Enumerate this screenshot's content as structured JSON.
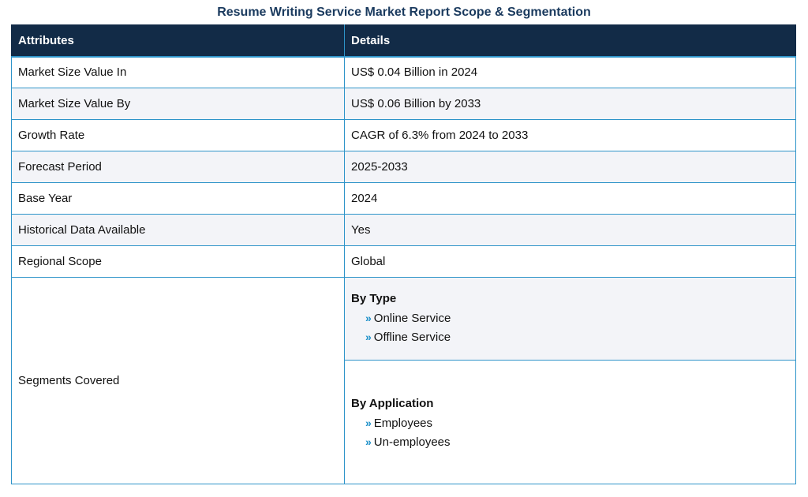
{
  "title": "Resume Writing Service Market Report Scope & Segmentation",
  "table": {
    "headers": [
      "Attributes",
      "Details"
    ],
    "rows": [
      {
        "attribute": "Market Size Value In",
        "detail": "US$ 0.04 Billion in 2024"
      },
      {
        "attribute": "Market Size Value By",
        "detail": "US$ 0.06 Billion by 2033"
      },
      {
        "attribute": "Growth Rate",
        "detail": "CAGR of 6.3% from 2024 to 2033"
      },
      {
        "attribute": "Forecast Period",
        "detail": "2025-2033"
      },
      {
        "attribute": "Base Year",
        "detail": "2024"
      },
      {
        "attribute": "Historical Data Available",
        "detail": "Yes"
      },
      {
        "attribute": "Regional Scope",
        "detail": "Global"
      }
    ],
    "segments": {
      "attribute": "Segments Covered",
      "groups": [
        {
          "heading": "By Type",
          "items": [
            "Online Service",
            "Offline Service"
          ]
        },
        {
          "heading": "By Application",
          "items": [
            "Employees",
            "Un-employees"
          ]
        }
      ]
    }
  },
  "icons": {
    "bullet": "double-chevron-right-icon",
    "bullet_glyph": "»"
  },
  "colors": {
    "header_bg": "#122b47",
    "title": "#1a3a5e",
    "border": "#2e94c9",
    "bullet": "#1a8fc8",
    "alt_row": "#f3f4f8"
  }
}
